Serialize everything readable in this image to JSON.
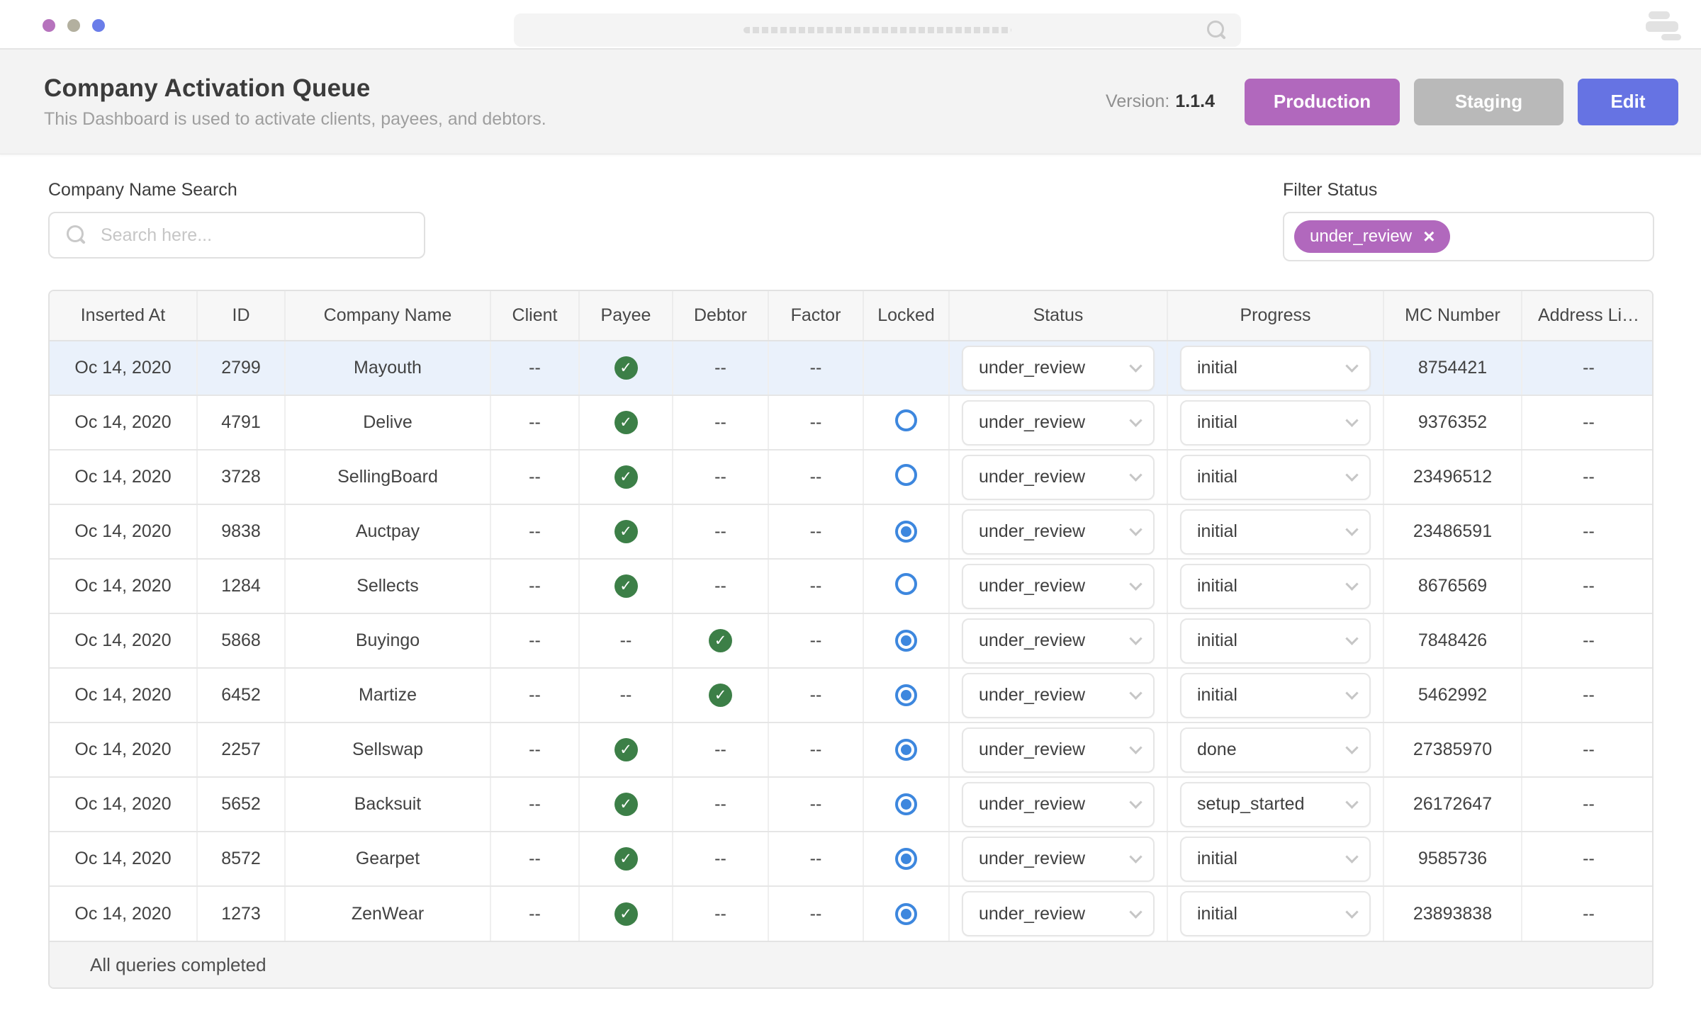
{
  "colors": {
    "production": "#b168bd",
    "staging": "#b9b9b9",
    "edit": "#6673e3",
    "chip": "#b168bd",
    "check_green": "#3c7f47",
    "radio_blue": "#3d87de",
    "row_highlight": "#eaf1fb",
    "dot_purple": "#b673bd",
    "dot_gray": "#b3b09f",
    "dot_blue": "#6a7de9"
  },
  "header": {
    "title": "Company Activation Queue",
    "subtitle": "This Dashboard is used to activate clients, payees, and debtors.",
    "version_label": "Version:",
    "version_value": "1.1.4",
    "production_label": "Production",
    "staging_label": "Staging",
    "edit_label": "Edit"
  },
  "controls": {
    "search_label": "Company Name Search",
    "search_placeholder": "Search here...",
    "filter_label": "Filter Status",
    "filter_chip": "under_review",
    "chip_close": "×"
  },
  "table": {
    "columns": [
      "Inserted At",
      "ID",
      "Company Name",
      "Client",
      "Payee",
      "Debtor",
      "Factor",
      "Locked",
      "Status",
      "Progress",
      "MC Number",
      "Address Li…"
    ],
    "rows": [
      {
        "date": "Oc 14, 2020",
        "id": "2799",
        "company": "Mayouth",
        "client": "--",
        "payee": "check",
        "debtor": "--",
        "factor": "--",
        "locked": "none",
        "status": "under_review",
        "progress": "initial",
        "mc": "8754421",
        "address": "--",
        "highlight": true
      },
      {
        "date": "Oc 14, 2020",
        "id": "4791",
        "company": "Delive",
        "client": "--",
        "payee": "check",
        "debtor": "--",
        "factor": "--",
        "locked": "unchecked",
        "status": "under_review",
        "progress": "initial",
        "mc": "9376352",
        "address": "--",
        "highlight": false
      },
      {
        "date": "Oc 14, 2020",
        "id": "3728",
        "company": "SellingBoard",
        "client": "--",
        "payee": "check",
        "debtor": "--",
        "factor": "--",
        "locked": "unchecked",
        "status": "under_review",
        "progress": "initial",
        "mc": "23496512",
        "address": "--",
        "highlight": false
      },
      {
        "date": "Oc 14, 2020",
        "id": "9838",
        "company": "Auctpay",
        "client": "--",
        "payee": "check",
        "debtor": "--",
        "factor": "--",
        "locked": "checked",
        "status": "under_review",
        "progress": "initial",
        "mc": "23486591",
        "address": "--",
        "highlight": false
      },
      {
        "date": "Oc 14, 2020",
        "id": "1284",
        "company": "Sellects",
        "client": "--",
        "payee": "check",
        "debtor": "--",
        "factor": "--",
        "locked": "unchecked",
        "status": "under_review",
        "progress": "initial",
        "mc": "8676569",
        "address": "--",
        "highlight": false
      },
      {
        "date": "Oc 14, 2020",
        "id": "5868",
        "company": "Buyingo",
        "client": "--",
        "payee": "--",
        "debtor": "check",
        "factor": "--",
        "locked": "checked",
        "status": "under_review",
        "progress": "initial",
        "mc": "7848426",
        "address": "--",
        "highlight": false
      },
      {
        "date": "Oc 14, 2020",
        "id": "6452",
        "company": "Martize",
        "client": "--",
        "payee": "--",
        "debtor": "check",
        "factor": "--",
        "locked": "checked",
        "status": "under_review",
        "progress": "initial",
        "mc": "5462992",
        "address": "--",
        "highlight": false
      },
      {
        "date": "Oc 14, 2020",
        "id": "2257",
        "company": "Sellswap",
        "client": "--",
        "payee": "check",
        "debtor": "--",
        "factor": "--",
        "locked": "checked",
        "status": "under_review",
        "progress": "done",
        "mc": "27385970",
        "address": "--",
        "highlight": false
      },
      {
        "date": "Oc 14, 2020",
        "id": "5652",
        "company": "Backsuit",
        "client": "--",
        "payee": "check",
        "debtor": "--",
        "factor": "--",
        "locked": "checked",
        "status": "under_review",
        "progress": "setup_started",
        "mc": "26172647",
        "address": "--",
        "highlight": false
      },
      {
        "date": "Oc 14, 2020",
        "id": "8572",
        "company": "Gearpet",
        "client": "--",
        "payee": "check",
        "debtor": "--",
        "factor": "--",
        "locked": "checked",
        "status": "under_review",
        "progress": "initial",
        "mc": "9585736",
        "address": "--",
        "highlight": false
      },
      {
        "date": "Oc 14, 2020",
        "id": "1273",
        "company": "ZenWear",
        "client": "--",
        "payee": "check",
        "debtor": "--",
        "factor": "--",
        "locked": "checked",
        "status": "under_review",
        "progress": "initial",
        "mc": "23893838",
        "address": "--",
        "highlight": false
      }
    ],
    "footer": "All queries completed"
  }
}
